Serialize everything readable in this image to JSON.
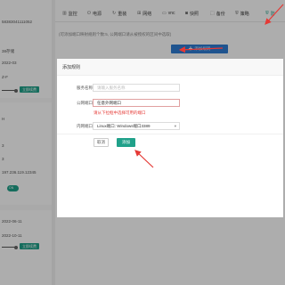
{
  "server_cards": [
    {
      "lines": [
        "58383041111052",
        "",
        "38存储",
        "2022-03",
        "",
        "Z-F"
      ],
      "renew_label": "立即续费"
    },
    {
      "lines": [
        "H",
        "",
        "3",
        "",
        "3",
        "197.236.119.12345"
      ],
      "toggle_label": "ON"
    },
    {
      "lines": [
        "2022-06-11",
        "",
        "2022-10-11"
      ],
      "renew_label": "立即续费"
    }
  ],
  "tabs": [
    {
      "label": "监控",
      "icon": "chart-icon",
      "active": false
    },
    {
      "label": "电源",
      "icon": "power-icon",
      "active": false
    },
    {
      "label": "重装",
      "icon": "reinstall-icon",
      "active": false
    },
    {
      "label": "网络",
      "icon": "network-icon",
      "active": false
    },
    {
      "label": "vnc",
      "icon": "monitor-icon",
      "active": false
    },
    {
      "label": "快照",
      "icon": "camera-icon",
      "active": false
    },
    {
      "label": "备份",
      "icon": "backup-icon",
      "active": false
    },
    {
      "label": "策略",
      "icon": "shield-icon",
      "active": false
    },
    {
      "label": "防",
      "icon": "shield-icon",
      "active": true
    }
  ],
  "tip_text": "(可添加端口映射规则个数:5, 公网端口请从被授权的区间中选取)",
  "add_rule_button": "添加规则",
  "dialog": {
    "title": "添加规则",
    "service_name_label": "服务名称",
    "service_name_placeholder": "请输入服务名称",
    "public_port_label": "公网端口",
    "public_port_value": "任意外网端口",
    "public_port_error": "请从下拉框中选择可用的端口",
    "internal_port_label": "内网端口",
    "internal_port_value": "Linux端口: Windows端口3389",
    "cancel_label": "取消",
    "submit_label": "添加"
  },
  "colors": {
    "accent": "#20a18a",
    "error": "#e53935",
    "annotation_arrow": "#e53935"
  }
}
